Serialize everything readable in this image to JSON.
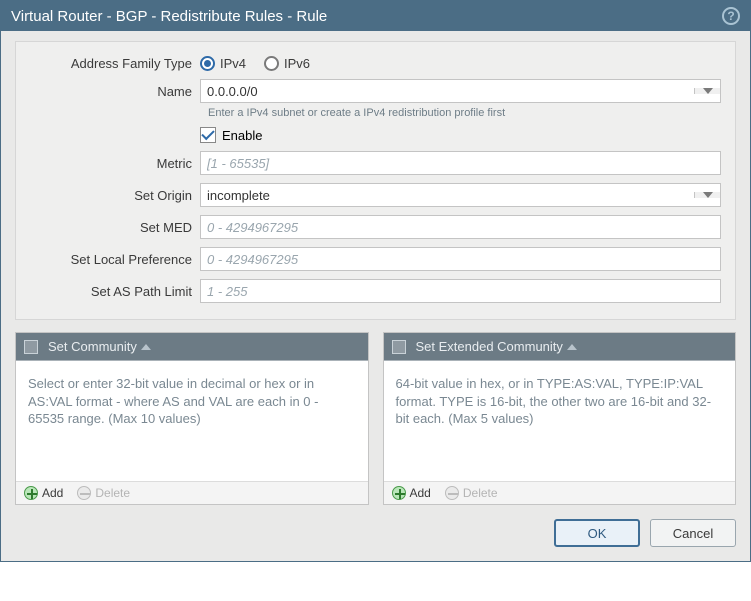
{
  "title": "Virtual Router - BGP - Redistribute Rules - Rule",
  "labels": {
    "address_family_type": "Address Family Type",
    "name": "Name",
    "enable": "Enable",
    "metric": "Metric",
    "set_origin": "Set Origin",
    "set_med": "Set MED",
    "set_local_pref": "Set Local Preference",
    "set_as_path_limit": "Set AS Path Limit"
  },
  "address_family": {
    "options": {
      "ipv4": "IPv4",
      "ipv6": "IPv6"
    },
    "selected": "ipv4"
  },
  "name": {
    "value": "0.0.0.0/0",
    "hint": "Enter a IPv4 subnet or create a IPv4 redistribution profile first"
  },
  "enable": true,
  "metric": {
    "value": "",
    "placeholder": "[1 - 65535]"
  },
  "set_origin": {
    "value": "incomplete"
  },
  "set_med": {
    "value": "",
    "placeholder": "0 - 4294967295"
  },
  "set_local_pref": {
    "value": "",
    "placeholder": "0 - 4294967295"
  },
  "set_as_path_limit": {
    "value": "",
    "placeholder": "1 - 255"
  },
  "panels": {
    "community": {
      "title": "Set Community",
      "body": "Select or enter 32-bit value in decimal or hex or in AS:VAL format - where AS and VAL are each in 0 - 65535 range. (Max 10 values)",
      "items": []
    },
    "ext_community": {
      "title": "Set Extended Community",
      "body": "64-bit value in hex, or in TYPE:AS:VAL, TYPE:IP:VAL format. TYPE is 16-bit, the other two are 16-bit and 32-bit each. (Max 5 values)",
      "items": []
    }
  },
  "toolbar": {
    "add": "Add",
    "delete": "Delete"
  },
  "buttons": {
    "ok": "OK",
    "cancel": "Cancel"
  }
}
